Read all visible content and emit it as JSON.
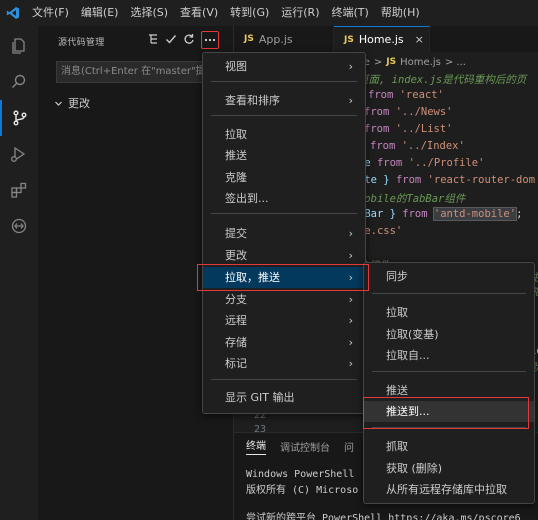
{
  "titlebar": {
    "menus": [
      "文件(F)",
      "编辑(E)",
      "选择(S)",
      "查看(V)",
      "转到(G)",
      "运行(R)",
      "终端(T)",
      "帮助(H)"
    ]
  },
  "activitybar": {
    "icons": [
      "explorer-icon",
      "search-icon",
      "source-control-icon",
      "run-debug-icon",
      "extensions-icon",
      "remote-icon"
    ]
  },
  "sidebar": {
    "title": "源代码管理",
    "commit_placeholder": "消息(Ctrl+Enter 在\"master\"提交)",
    "changes_label": "更改"
  },
  "tabs": [
    {
      "badge": "JS",
      "label": "App.js",
      "active": false
    },
    {
      "badge": "JS",
      "label": "Home.js",
      "active": true,
      "close": "×"
    }
  ],
  "breadcrumb": {
    "first": "me",
    "sep": ">",
    "badge": "JS",
    "file": "Home.js",
    "rest": "> ..."
  },
  "code": {
    "l0": "页面, index.js是代码重构后的页",
    "l1a": "from ",
    "l1b": "'react'",
    "l2a": "from ",
    "l2b": "'../News'",
    "l3a": "from ",
    "l3b": "'../List'",
    "l4a": "from ",
    "l4b": "'../Index'",
    "l5a": "le ",
    "l5b": "from ",
    "l5c": "'../Profile'",
    "l6a": "ute } ",
    "l6b": "from ",
    "l6c": "'react-router-dom",
    "l7": "mobile的TabBar组件",
    "l8a": "bBar } ",
    "l8b": "from ",
    "l8c": "'antd-mobile'",
    "l8d": ";",
    "l9": "me.css'",
    "l10": "件组件",
    "l11": "主要",
    "l12": "能",
    "l13": "io",
    "l14": "默",
    "ln1": "22",
    "ln2": "23"
  },
  "panel": {
    "tabs": [
      "终端",
      "调试控制台",
      "问"
    ],
    "lines": [
      "Windows PowerShell",
      "版权所有 (C) Microso",
      "",
      "尝试新的跨平台 PowerShell https://aka.ms/pscore6"
    ]
  },
  "main_menu": {
    "items": [
      "视图",
      "查看和排序",
      "拉取",
      "推送",
      "克隆",
      "签出到...",
      "提交",
      "更改",
      "拉取，推送",
      "分支",
      "远程",
      "存储",
      "标记",
      "显示 GIT 输出"
    ]
  },
  "sub_menu": {
    "items": [
      "同步",
      "拉取",
      "拉取(变基)",
      "拉取自...",
      "推送",
      "推送到...",
      "抓取",
      "获取 (删除)",
      "从所有远程存储库中拉取"
    ]
  }
}
